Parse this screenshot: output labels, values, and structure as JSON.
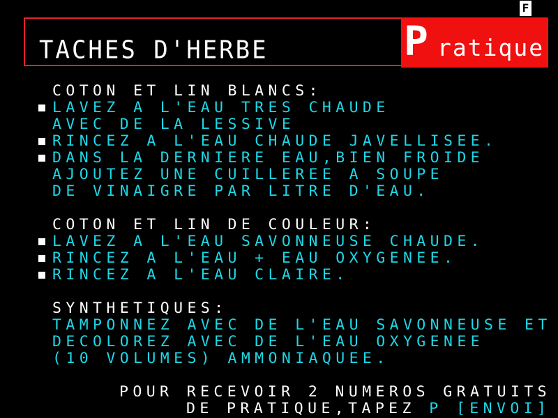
{
  "badge": "F",
  "header": {
    "title": "TACHES D'HERBE",
    "logo_initial": "P",
    "logo_rest": "ratique",
    "colors": {
      "border": "#e8202a",
      "logo_bg": "#f01010"
    }
  },
  "sections": [
    {
      "heading": "COTON ET LIN BLANCS:",
      "lines": [
        "LAVEZ A L'EAU TRES CHAUDE",
        "AVEC DE LA LESSIVE",
        "RINCEZ A L'EAU CHAUDE JAVELLISEE.",
        "DANS LA DERNIERE EAU,BIEN FROIDE",
        "AJOUTEZ UNE CUILLEREE A SOUPE",
        "DE VINAIGRE PAR LITRE D'EAU."
      ]
    },
    {
      "heading": "COTON ET LIN DE COULEUR:",
      "lines": [
        "LAVEZ A L'EAU SAVONNEUSE CHAUDE.",
        "RINCEZ A L'EAU + EAU OXYGENEE.",
        "RINCEZ A L'EAU CLAIRE."
      ]
    },
    {
      "heading": "SYNTHETIQUES:",
      "lines": [
        "TAMPONNEZ AVEC DE L'EAU SAVONNEUSE ET",
        "DECOLOREZ AVEC DE L'EAU OXYGENEE",
        "(10 VOLUMES) AMMONIAQUEE."
      ]
    }
  ],
  "footer": {
    "line1": "POUR RECEVOIR 2 NUMEROS GRATUITS",
    "line2_prefix": "DE PRATIQUE,TAPEZ",
    "key": "P",
    "action": "[ENVOI]"
  },
  "colors": {
    "background": "#000000",
    "text": "#ffffff",
    "cyan": "#1ed7e6"
  }
}
